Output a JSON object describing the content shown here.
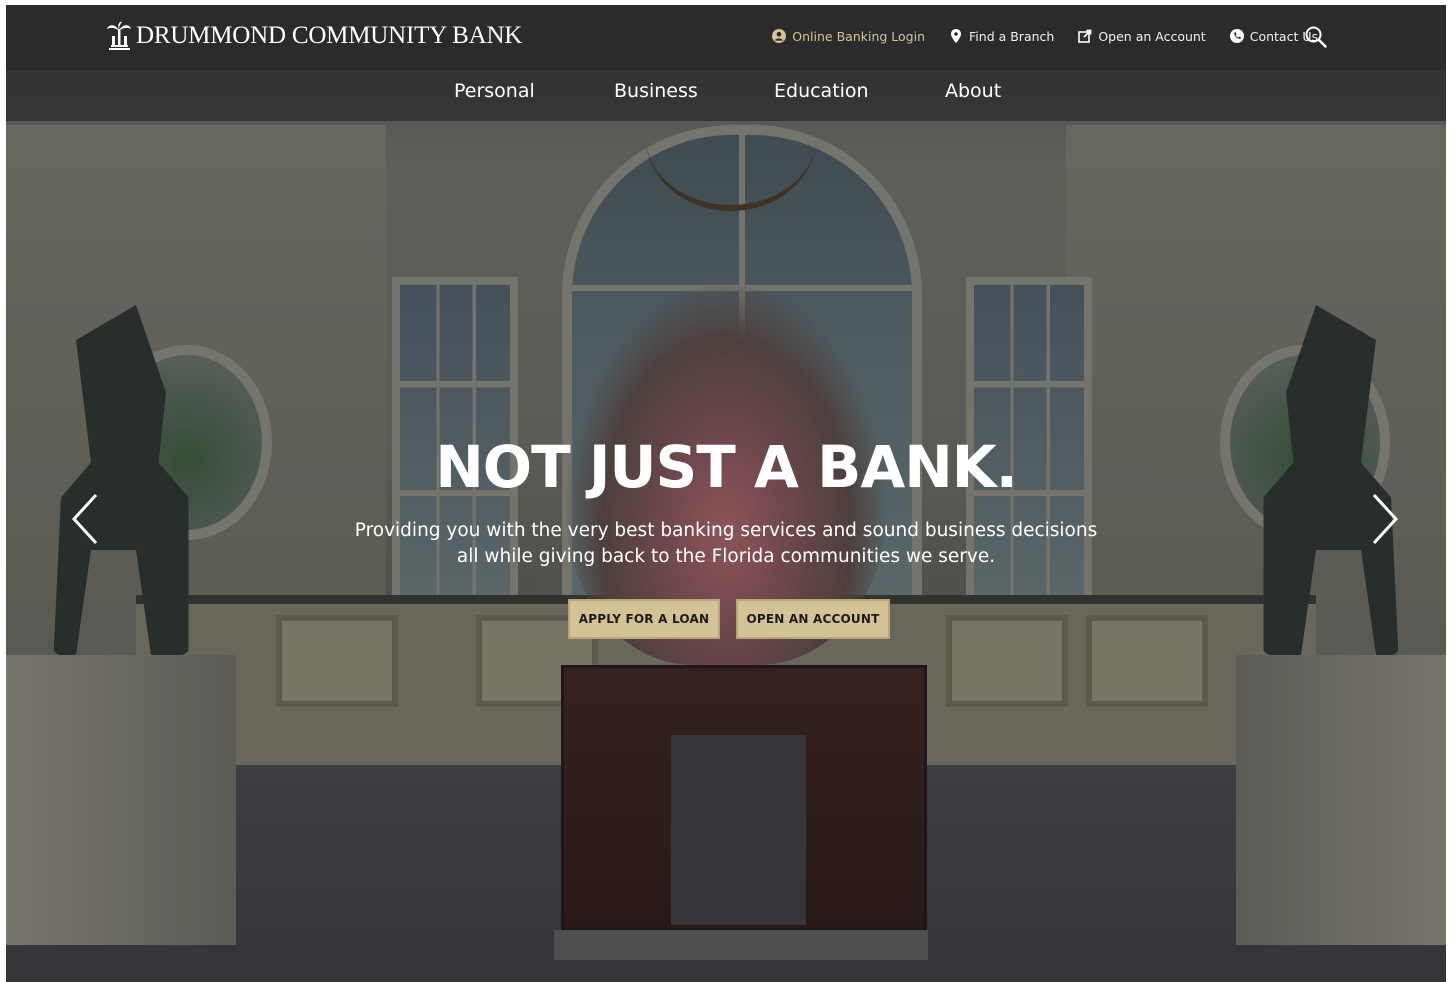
{
  "brand": {
    "name": "DRUMMOND COMMUNITY BANK",
    "logo_icon": "palm-tree-icon"
  },
  "utility_nav": [
    {
      "label": "Online Banking Login",
      "icon": "user-circle-icon",
      "color": "#d7c394"
    },
    {
      "label": "Find a Branch",
      "icon": "map-pin-icon",
      "color": "#f2f2f2"
    },
    {
      "label": "Open an Account",
      "icon": "external-edit-icon",
      "color": "#f2f2f2"
    },
    {
      "label": "Contact Us",
      "icon": "phone-circle-icon",
      "color": "#f2f2f2"
    }
  ],
  "search": {
    "icon": "search-icon"
  },
  "main_nav": [
    {
      "label": "Personal"
    },
    {
      "label": "Business"
    },
    {
      "label": "Education"
    },
    {
      "label": "About"
    }
  ],
  "hero": {
    "title": "NOT JUST A BANK.",
    "subtitle_line1": "Providing you with the very best banking services and sound business decisions",
    "subtitle_line2": "all while giving back to the Florida communities we serve.",
    "buttons": [
      {
        "label": "APPLY FOR A LOAN"
      },
      {
        "label": "OPEN AN ACCOUNT"
      }
    ],
    "prev_icon": "chevron-left-icon",
    "next_icon": "chevron-right-icon"
  },
  "colors": {
    "header_bg": "#282828",
    "gold_accent": "#d3c295",
    "login_text": "#d7c394"
  }
}
